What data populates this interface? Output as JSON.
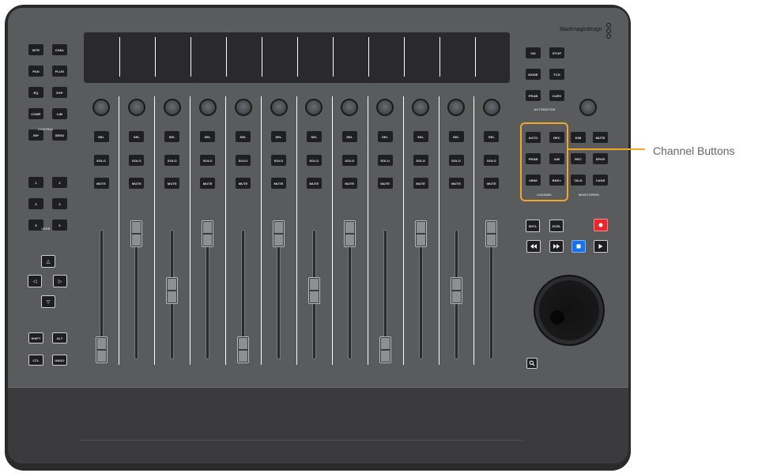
{
  "brand": {
    "name": "Blackmagicdesign"
  },
  "callout": {
    "label": "Channel Buttons",
    "color": "#f1a82a"
  },
  "left_panel": {
    "control_keys": [
      [
        "MTR",
        "CHNL"
      ],
      [
        "PAN",
        "PLUG"
      ],
      [
        "EQ",
        "EXP"
      ],
      [
        "COMP",
        "LIM"
      ],
      [
        "INP",
        "SEND"
      ]
    ],
    "control_label": "CONTROL",
    "user_keys": [
      [
        "1",
        "2"
      ],
      [
        "3",
        "4"
      ],
      [
        "5",
        "6"
      ]
    ],
    "user_label": "USER",
    "nav_icons": [
      "arrow-up-icon",
      "arrow-left-icon",
      "arrow-right-icon",
      "arrow-down-icon"
    ],
    "modifier_keys": [
      [
        "SHIFT",
        "ALT"
      ],
      [
        "CTL",
        "UNDO"
      ]
    ]
  },
  "channel_strip": {
    "sel": "SEL",
    "solo": "SOLO",
    "mute": "MUTE",
    "fader_levels": [
      0.15,
      0.9,
      0.6,
      0.9,
      0.15,
      0.9,
      0.6,
      0.9,
      0.15,
      0.9,
      0.6,
      0.9
    ]
  },
  "automation": {
    "keys": [
      [
        "ON",
        "STOP"
      ],
      [
        "MODE",
        "TCH"
      ],
      [
        "PRAB",
        "CURV"
      ]
    ],
    "label": "AUTOMATION"
  },
  "channel_group": {
    "keys": [
      [
        "AUTO",
        "REC"
      ],
      [
        "PRAB",
        "A/B"
      ],
      [
        "<BNK",
        "BNK>"
      ]
    ],
    "label": "CHANNEL"
  },
  "monitoring": {
    "keys": [
      [
        "DIM",
        "MUTE"
      ],
      [
        "REC",
        "SPKR"
      ],
      [
        "TALK",
        "CANS"
      ]
    ],
    "label": "MONITORING"
  },
  "transport": {
    "top_keys": [
      "SHTL",
      "SCRL"
    ],
    "record_icon": "record-icon",
    "icons": [
      "rewind-icon",
      "fast-forward-icon",
      "stop-icon",
      "play-icon"
    ],
    "record_color": "#e8262b",
    "stop_color": "#1a73e8"
  },
  "zoom_icon": "magnifier-icon"
}
